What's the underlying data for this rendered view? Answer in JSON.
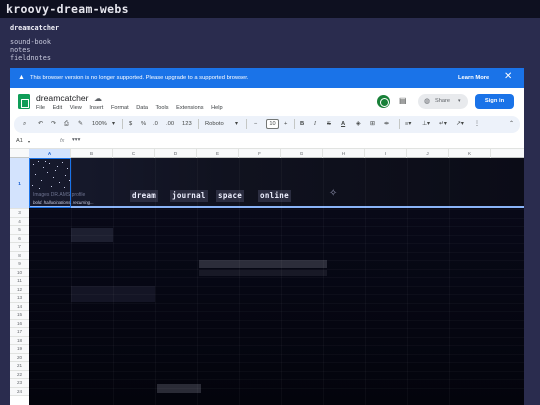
{
  "site": {
    "title": "kroovy-dream-webs",
    "brand": "dreamcatcher",
    "nav": [
      "sound-book",
      "notes",
      "fieldnotes"
    ]
  },
  "banner": {
    "message": "This browser version is no longer supported. Please upgrade to a supported browser.",
    "learn_more": "Learn More",
    "close_icon": "close-icon"
  },
  "sheet": {
    "doc_title": "dreamcatcher",
    "menu": [
      "File",
      "Edit",
      "View",
      "Insert",
      "Format",
      "Data",
      "Tools",
      "Extensions",
      "Help"
    ],
    "share_label": "Share",
    "signin_label": "Sign in"
  },
  "toolbar": {
    "zoom": "100%",
    "currency": "$",
    "percent": "%",
    "dec_decrease": ".0",
    "dec_increase": ".00",
    "format_more": "123",
    "font": "Roboto",
    "font_size": "10",
    "minus": "−",
    "plus": "+",
    "bold": "B",
    "italic": "I",
    "strikethrough": "S",
    "text_color": "A"
  },
  "formula_bar": {
    "cell_ref": "A1",
    "fx": "fx",
    "content": "▾▾▾"
  },
  "grid": {
    "columns": [
      "A",
      "B",
      "C",
      "D",
      "E",
      "F",
      "G",
      "H",
      "I",
      "J",
      "K"
    ],
    "rows": [
      "1",
      "3",
      "4",
      "5",
      "6",
      "7",
      "8",
      "9",
      "10",
      "11",
      "12",
      "13",
      "14",
      "15",
      "16",
      "17",
      "18",
      "19",
      "20",
      "21",
      "22",
      "23",
      "24"
    ],
    "cell_text": "Images DR.AMS profile",
    "tagline": "bold. hallucinations. recurring...",
    "nav_tags": [
      "dream",
      "journal",
      "space",
      "online"
    ]
  },
  "colors": {
    "banner": "#1a73e8",
    "page_bg": "#2a2c4e",
    "accent": "#0f9d58"
  }
}
